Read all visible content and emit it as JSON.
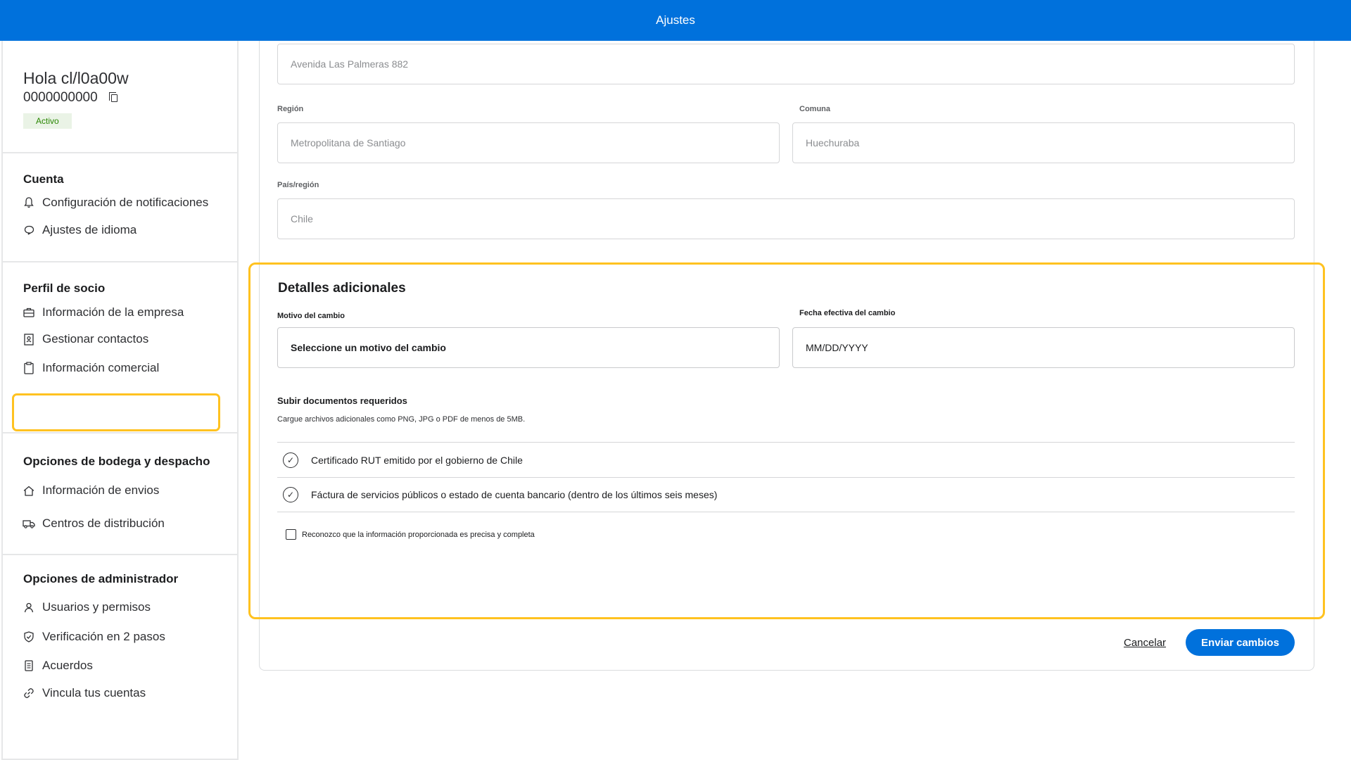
{
  "header": {
    "title": "Ajustes"
  },
  "profile": {
    "greeting": "Hola cl/l0a00w",
    "account_id": "0000000000",
    "status": "Activo"
  },
  "sidebar": {
    "account": {
      "title": "Cuenta",
      "items": [
        {
          "label": "Configuración de notificaciones",
          "icon": "bell-icon"
        },
        {
          "label": "Ajustes de idioma",
          "icon": "speech-bubble-icon"
        }
      ]
    },
    "partner": {
      "title": "Perfil de socio",
      "items": [
        {
          "label": "Información de la empresa",
          "icon": "briefcase-icon"
        },
        {
          "label": "Gestionar contactos",
          "icon": "contact-book-icon"
        },
        {
          "label": "Información comercial",
          "icon": "clipboard-icon"
        }
      ]
    },
    "warehouse": {
      "title": "Opciones de bodega y despacho",
      "items": [
        {
          "label": "Información de envios",
          "icon": "home-icon"
        },
        {
          "label": "Centros de distribución",
          "icon": "truck-icon"
        }
      ]
    },
    "admin": {
      "title": "Opciones de administrador",
      "items": [
        {
          "label": "Usuarios y permisos",
          "icon": "user-icon"
        },
        {
          "label": "Verificación en 2 pasos",
          "icon": "shield-check-icon"
        },
        {
          "label": "Acuerdos",
          "icon": "document-icon"
        },
        {
          "label": "Vincula tus cuentas",
          "icon": "link-icon"
        }
      ]
    }
  },
  "address": {
    "street": "Avenida Las Palmeras 882",
    "region_label": "Región",
    "region": "Metropolitana de Santiago",
    "commune_label": "Comuna",
    "commune": "Huechuraba",
    "country_label": "País/región",
    "country": "Chile"
  },
  "details": {
    "heading": "Detalles adicionales",
    "reason_label": "Motivo del cambio",
    "reason_placeholder": "Seleccione un motivo del cambio",
    "date_label": "Fecha efectiva del cambio",
    "date_placeholder": "MM/DD/YYYY",
    "upload_title": "Subir documentos requeridos",
    "upload_desc": "Cargue archivos adicionales como PNG, JPG o PDF de menos de 5MB.",
    "documents": [
      "Certificado RUT emitido por el gobierno de Chile",
      "Fáctura de servicios públicos o estado de cuenta bancario (dentro de los últimos seis meses)"
    ],
    "acknowledge": "Reconozco que la información proporcionada es precisa y completa"
  },
  "actions": {
    "cancel": "Cancelar",
    "submit": "Enviar cambios"
  },
  "colors": {
    "brand_blue": "#0071dc",
    "highlight": "#ffc220",
    "status_green": "#2a8703"
  }
}
